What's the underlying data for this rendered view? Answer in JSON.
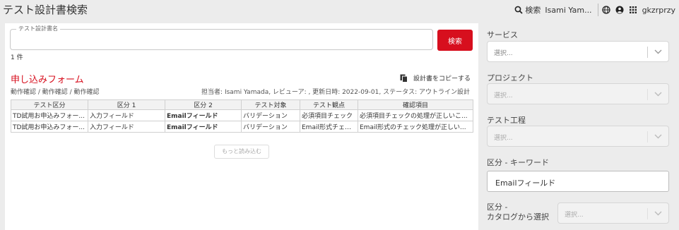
{
  "app": {
    "title": "テスト設計書検索"
  },
  "header": {
    "search_label": "検索",
    "user_name": "Isami Yam...",
    "user_id": "gkzrprzy",
    "icons": [
      "search-icon",
      "globe-icon",
      "user-icon",
      "apps-grid-icon"
    ]
  },
  "search": {
    "field_label": "テスト設計書名",
    "value": "",
    "button_label": "検索",
    "result_count": "1 件"
  },
  "result": {
    "title": "申し込みフォーム",
    "breadcrumb": "動作確認 / 動作確認 / 動作確認",
    "copy_label": "設計書をコピーする",
    "meta": "担当者: Isami Yamada, レビューア: , 更新日時: 2022-09-01, ステータス: アウトライン設計",
    "columns": [
      "テスト区分",
      "区分 1",
      "区分 2",
      "テスト対象",
      "テスト観点",
      "確認項目"
    ],
    "rows": [
      [
        "TD試用お申込みフォー...",
        "入力フィールド",
        "Emailフィールド",
        "バリデーション",
        "必須項目チェック",
        "必須項目チェックの処理が正しいこ..."
      ],
      [
        "TD試用お申込みフォー...",
        "入力フィールド",
        "Emailフィールド",
        "バリデーション",
        "Email形式チェッ...",
        "Email形式のチェック処理が正しい..."
      ]
    ],
    "load_more_label": "もっと読み込む"
  },
  "filters": {
    "service": {
      "label": "サービス",
      "value": "選択..."
    },
    "project": {
      "label": "プロジェクト",
      "value": "選択..."
    },
    "process": {
      "label": "テスト工程",
      "value": "選択..."
    },
    "keyword": {
      "label": "区分 - キーワード",
      "value": "Emailフィールド"
    },
    "catalog": {
      "label_line1": "区分 -",
      "label_line2": "カタログから選択",
      "value": "選択..."
    }
  },
  "colors": {
    "accent": "#d70f1e",
    "background": "#ececec"
  }
}
